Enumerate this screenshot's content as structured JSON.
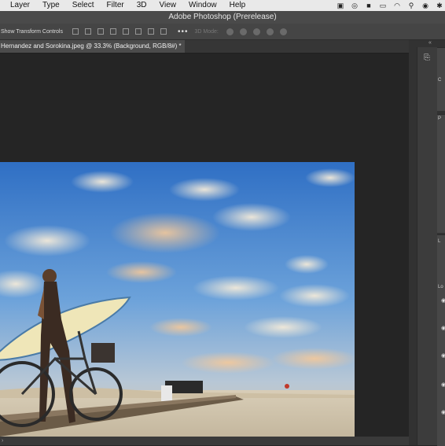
{
  "menu": [
    "Layer",
    "Type",
    "Select",
    "Filter",
    "3D",
    "View",
    "Window",
    "Help"
  ],
  "menubar_icons": [
    "camera-icon",
    "creative-cloud-icon",
    "video-icon",
    "display-icon",
    "wifi-icon",
    "search-icon",
    "accessibility-icon",
    "bluetooth-icon"
  ],
  "window_title": "Adobe Photoshop (Prerelease)",
  "options": {
    "show_transform_controls": "Show Transform Controls",
    "more": "•••",
    "mode_3d": "3D Mode:"
  },
  "document": {
    "tab_title": "Hernandez and Sorokina.jpeg @ 33.3% (Background, RGB/8#) *"
  },
  "panels": {
    "color_label": "C",
    "properties_label": "P",
    "layers_label": "L",
    "lock_label": "Lo"
  },
  "colors": {
    "workspace": "#262626",
    "menubar": "#e9e9e9",
    "panel": "#3c3c3c"
  }
}
